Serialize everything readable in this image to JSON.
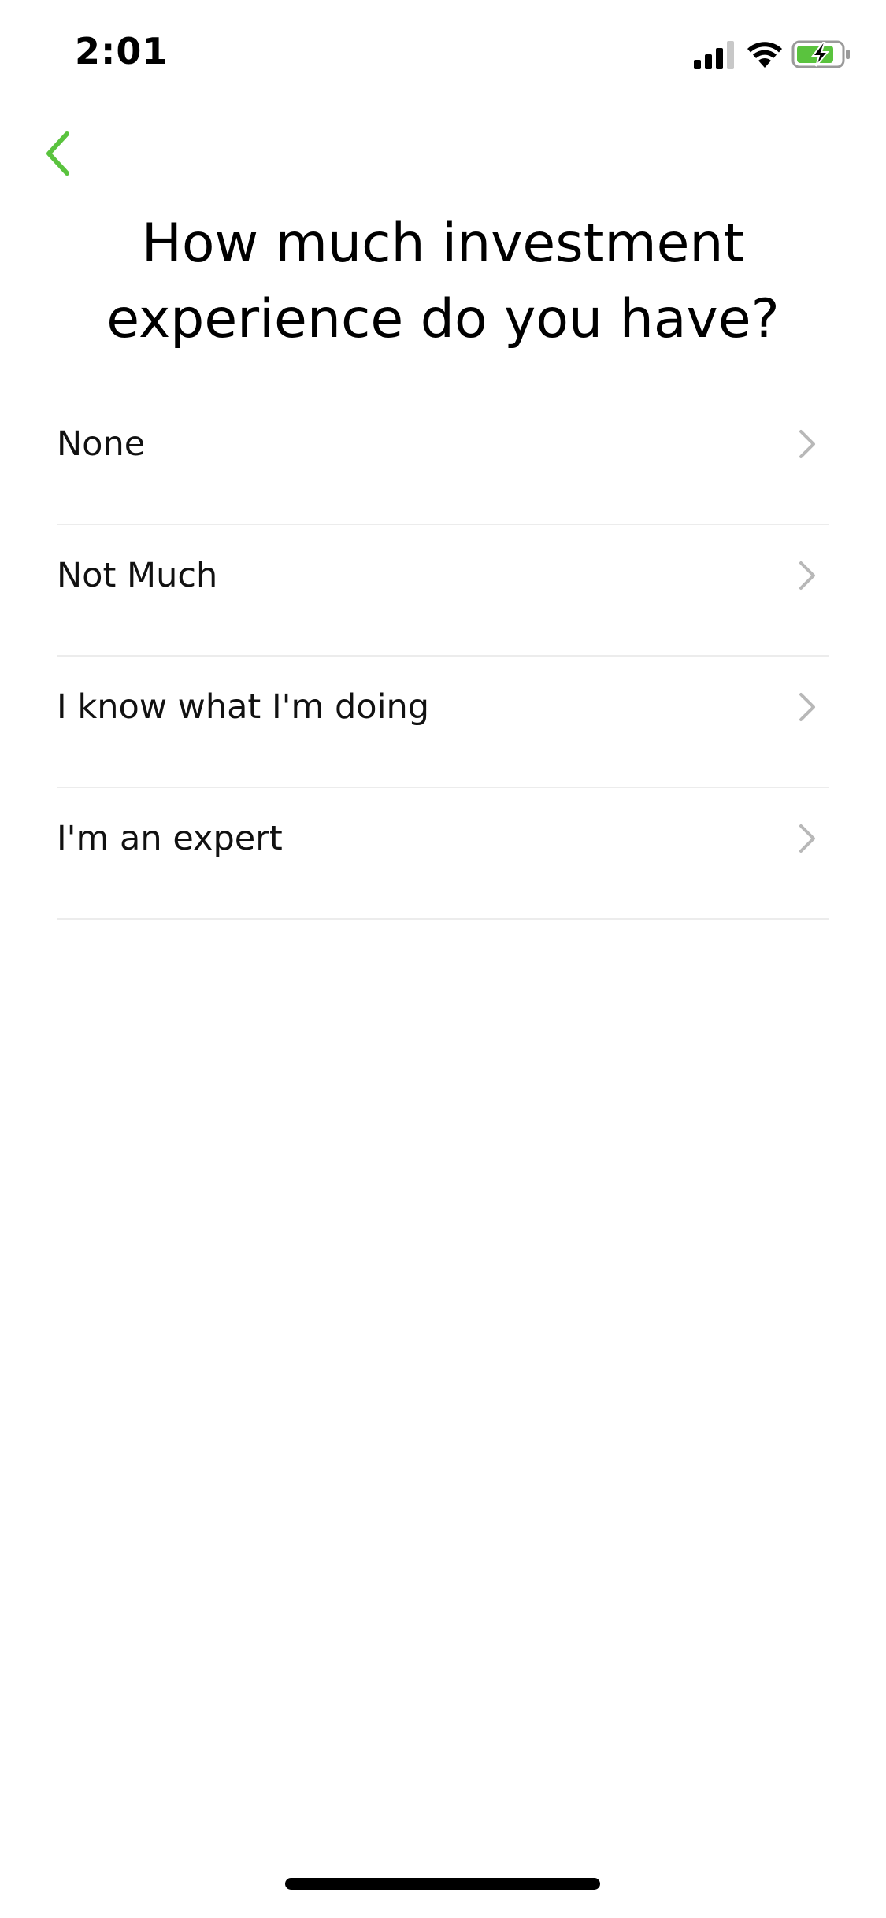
{
  "status_bar": {
    "time": "2:01",
    "icons": [
      "cellular-signal-icon",
      "wifi-icon",
      "battery-charging-icon"
    ]
  },
  "header": {
    "back_icon": "chevron-left-icon",
    "title": "How much investment experience do you have?"
  },
  "options": [
    {
      "label": "None",
      "icon": "chevron-right-icon"
    },
    {
      "label": "Not Much",
      "icon": "chevron-right-icon"
    },
    {
      "label": "I know what I'm doing",
      "icon": "chevron-right-icon"
    },
    {
      "label": "I'm an expert",
      "icon": "chevron-right-icon"
    }
  ],
  "colors": {
    "accent": "#5ac33e",
    "text": "#111111",
    "chevron": "#b8b8b8",
    "divider": "#ececec",
    "battery_fill": "#5ac33e"
  }
}
